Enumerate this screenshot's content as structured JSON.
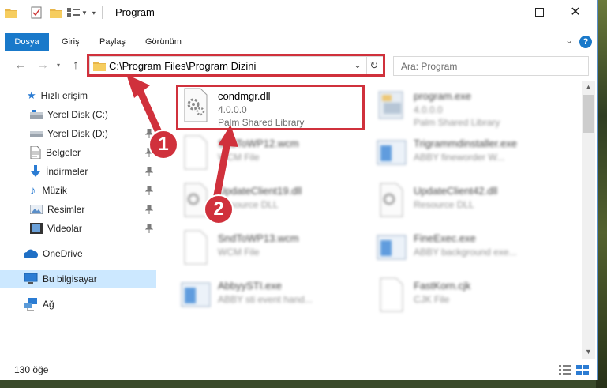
{
  "window": {
    "title": "Program"
  },
  "ribbon": {
    "tabs": [
      "Dosya",
      "Giriş",
      "Paylaş",
      "Görünüm"
    ],
    "help": "?"
  },
  "address": {
    "path": "C:\\Program Files\\Program Dizini"
  },
  "search": {
    "placeholder": "Ara: Program"
  },
  "nav": {
    "quick_access": "Hızlı erişim",
    "items": [
      "Yerel Disk (C:)",
      "Yerel Disk (D:)",
      "Belgeler",
      "İndirmeler",
      "Müzik",
      "Resimler",
      "Videolar"
    ],
    "onedrive": "OneDrive",
    "this_pc": "Bu bilgisayar",
    "network": "Ağ"
  },
  "files": {
    "left": [
      {
        "name": "condmgr.dll",
        "line2": "4.0.0.0",
        "line3": "Palm Shared Library"
      },
      {
        "name": "SndToWP12.wcm",
        "line2": "WCM File",
        "line3": ""
      },
      {
        "name": "UpdateClient19.dll",
        "line2": "Resource DLL",
        "line3": ""
      },
      {
        "name": "SndToWP13.wcm",
        "line2": "WCM File",
        "line3": ""
      },
      {
        "name": "AbbyySTI.exe",
        "line2": "ABBY sti event hand...",
        "line3": ""
      }
    ],
    "right": [
      {
        "name": "program.exe",
        "line2": "4.0.0.0",
        "line3": "Palm Shared Library"
      },
      {
        "name": "Trigrammdinstaller.exe",
        "line2": "ABBY fineworder W...",
        "line3": ""
      },
      {
        "name": "UpdateClient42.dll",
        "line2": "Resource DLL",
        "line3": ""
      },
      {
        "name": "FineExec.exe",
        "line2": "ABBY background exe...",
        "line3": ""
      },
      {
        "name": "FastKorn.cjk",
        "line2": "CJK File",
        "line3": ""
      }
    ]
  },
  "status": {
    "count": "130 öğe"
  },
  "callouts": [
    "1",
    "2"
  ],
  "colors": {
    "accent": "#1979ca",
    "annotation": "#d0313c",
    "selected": "#cce8ff"
  }
}
